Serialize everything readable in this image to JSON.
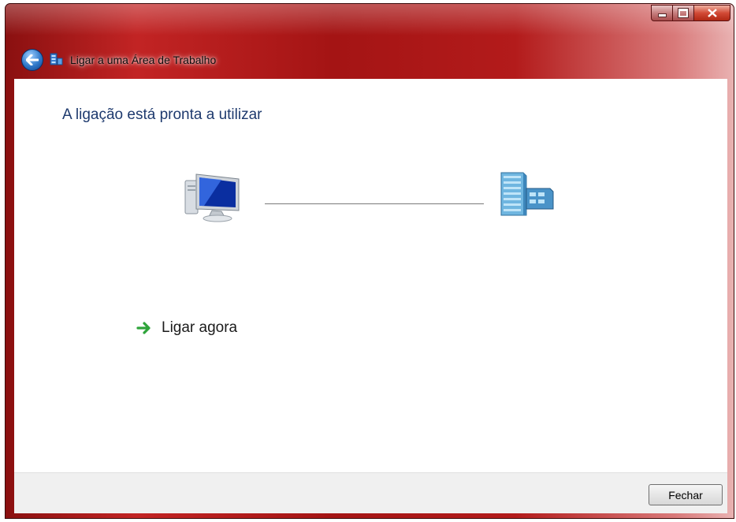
{
  "window": {
    "title": "Ligar a uma Área de Trabalho",
    "controls": [
      "minimize",
      "maximize",
      "close"
    ]
  },
  "main": {
    "heading": "A ligação está pronta a utilizar",
    "diagram": {
      "left_icon": "computer-icon",
      "right_icon": "server-building-icon"
    },
    "action_link": "Ligar agora"
  },
  "footer": {
    "close_label": "Fechar"
  },
  "colors": {
    "titlebar": "#b31b1b",
    "heading": "#1e3a6e",
    "footer_bg": "#f0f0f0"
  }
}
